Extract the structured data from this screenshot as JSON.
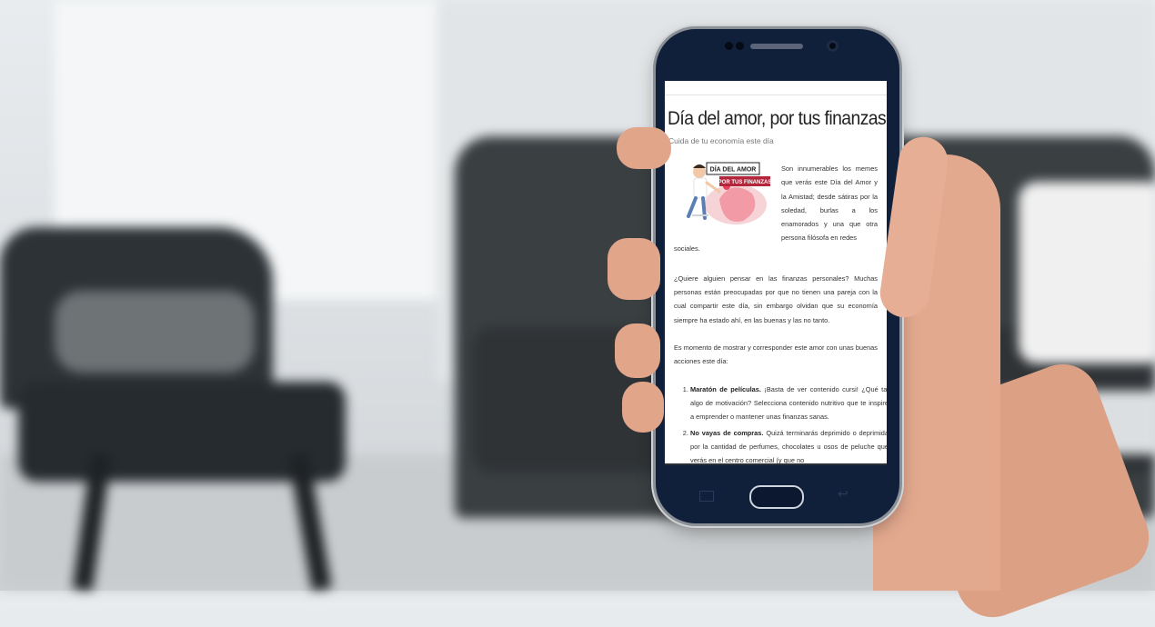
{
  "screen": {
    "title": "Día del amor, por tus finanzas",
    "subtitle": "Cuida de tu economía este día",
    "illustration": {
      "line1": "DÍA DEL AMOR",
      "line2": "POR TUS FINANZAS"
    },
    "intro": "Son innumerables los memes que verás este Día del Amor y la Amistad; desde sátiras por la soledad, burlas a los enamorados y una que otra persona filósofa en redes",
    "intro_tail": "sociales.",
    "paragraph2": "¿Quiere alguien pensar en las finanzas personales? Muchas personas están preocupadas por que no tienen una pareja con la cual compartir este día, sin embargo olvidan que su economía siempre ha estado ahí, en las buenas y las no tanto.",
    "paragraph3": "Es momento de mostrar y corresponder este amor con unas buenas acciones este día:",
    "list": [
      {
        "bold": "Maratón de películas.",
        "text": " ¡Basta de ver contenido cursi! ¿Qué tal algo de motivación? Selecciona contenido nutritivo que te inspire a emprender o mantener unas finanzas sanas."
      },
      {
        "bold": "No vayas de compras.",
        "text": " Quizá terminarás deprimido o deprimida por la cantidad de perfumes, chocolates u osos de peluche que verás en el centro comercial (y que no"
      }
    ]
  },
  "colors": {
    "phone_body": "#11203a",
    "illustration_banner": "#b3263b",
    "skin": "#e3a98f"
  }
}
